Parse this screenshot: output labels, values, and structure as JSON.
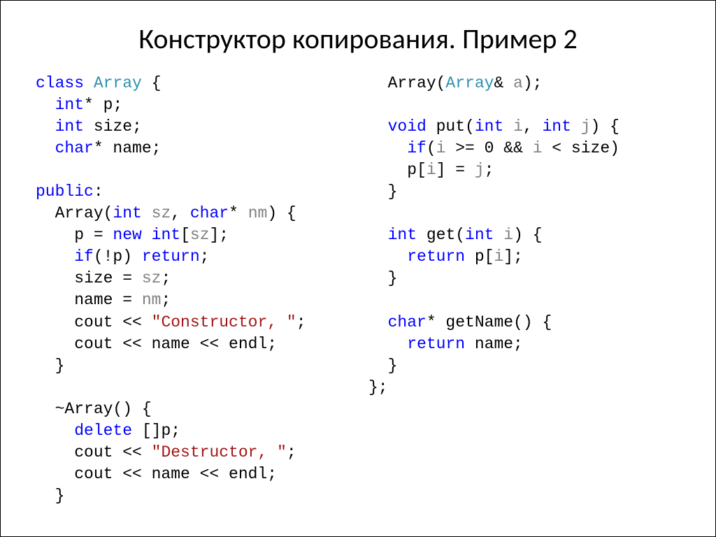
{
  "title": "Конструктор копирования. Пример 2",
  "t": {
    "class": "class",
    "Array": "Array",
    "int": "int",
    "char": "char",
    "public": "public",
    "new": "new",
    "if_1": "if",
    "return_1": "return",
    "delete": "delete",
    "void": "void",
    "if_2": "if",
    "return_2": "return",
    "return_3": "return",
    "sz1": "sz",
    "sz2": "sz",
    "sz3": "sz",
    "nm1": "nm",
    "nm2": "nm",
    "a": "a",
    "i1": "i",
    "i2": "i",
    "i3": "i",
    "i4": "i",
    "i5": "i",
    "j1": "j",
    "j2": "j",
    "strConstructor": "\"Constructor, \"",
    "strDestructor": "\"Destructor, \"",
    "sym_lbrace": "{",
    "sym_rbrace": "}",
    "line_p": "* p;",
    "line_size": " size;",
    "line_name": "* name;",
    "line_publicColon": ":",
    "line_ctor_sig_1": "  Array(",
    "line_ctor_sig_2": " ",
    "line_ctor_sig_3": ", ",
    "line_ctor_sig_4": "* ",
    "line_ctor_sig_5": ") {",
    "line_p_assign_1": "    p = ",
    "line_p_assign_2": " ",
    "line_p_assign_3": "[",
    "line_p_assign_4": "];",
    "line_ifp_1": "    ",
    "line_ifp_2": "(!p) ",
    "line_ifp_3": ";",
    "line_size_assign_1": "    size = ",
    "line_size_assign_2": ";",
    "line_name_assign_1": "    name = ",
    "line_name_assign_2": ";",
    "line_cout_ctor": "    cout << ",
    "line_semicolon": ";",
    "line_cout_name": "    cout << name << endl;",
    "line_close_brace": "  }",
    "line_blank": "",
    "line_dtor": "  ~Array() {",
    "line_delete_1": "    ",
    "line_delete_2": " []p;",
    "line_cout_dtor": "    cout << ",
    "line_copyctor_1": "  Array(",
    "line_copyctor_2": "& ",
    "line_copyctor_3": ");",
    "line_put_1": "  ",
    "line_put_2": " put(",
    "line_put_3": " ",
    "line_put_4": ", ",
    "line_put_5": " ",
    "line_put_6": ") {",
    "line_ifcond_1": "    ",
    "line_ifcond_2": "(",
    "line_ifcond_3": " >= 0 && ",
    "line_ifcond_4": " < size)",
    "line_pij_1": "    p[",
    "line_pij_2": "] = ",
    "line_pij_3": ";",
    "line_get_1": "  ",
    "line_get_2": " get(",
    "line_get_3": " ",
    "line_get_4": ") {",
    "line_ret_pi_1": "    ",
    "line_ret_pi_2": " p[",
    "line_ret_pi_3": "];",
    "line_getname_1": "  ",
    "line_getname_2": "* getName() {",
    "line_ret_name_1": "    ",
    "line_ret_name_2": " name;",
    "line_class_end": "};"
  }
}
